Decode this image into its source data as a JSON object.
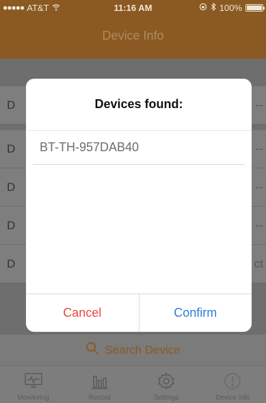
{
  "status_bar": {
    "carrier": "AT&T",
    "time": "11:16 AM",
    "battery": "100%",
    "battery_level": 1.0
  },
  "nav": {
    "title": "Device Info"
  },
  "rows": [
    {
      "label": "D",
      "value": "--"
    },
    {
      "label": "D",
      "value": "--"
    },
    {
      "label": "D",
      "value": "--"
    },
    {
      "label": "D",
      "value": "--"
    },
    {
      "label": "D",
      "value": "ct"
    }
  ],
  "search_button": {
    "label": "Search Device"
  },
  "tabs": [
    {
      "label": "Monitoring",
      "icon": "monitor-icon"
    },
    {
      "label": "Record",
      "icon": "chart-icon"
    },
    {
      "label": "Settings",
      "icon": "gear-icon"
    },
    {
      "label": "Device Info",
      "icon": "info-icon"
    }
  ],
  "dialog": {
    "title": "Devices found:",
    "devices": [
      "BT-TH-957DAB40"
    ],
    "cancel_label": "Cancel",
    "confirm_label": "Confirm"
  },
  "colors": {
    "brand": "#8a5a22",
    "cancel": "#e8483f",
    "confirm": "#2a7fd8"
  }
}
